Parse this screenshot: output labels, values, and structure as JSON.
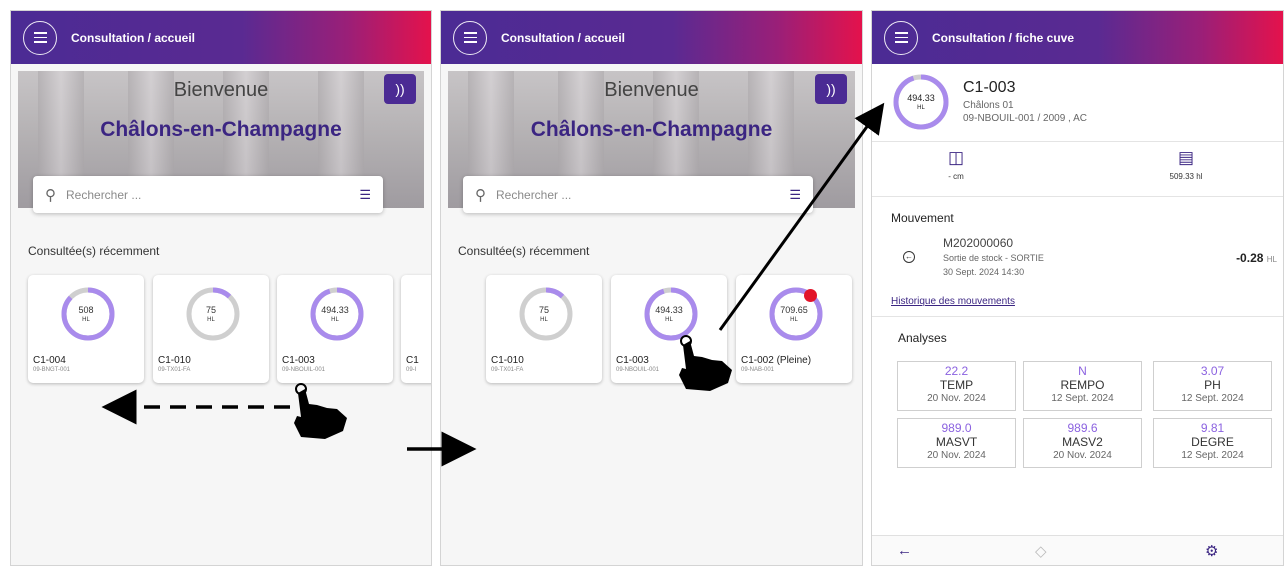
{
  "screens": [
    {
      "title": "Consultation / accueil",
      "welcome": "Bienvenue",
      "city": "Châlons-en-Champagne",
      "search_placeholder": "Rechercher ...",
      "recent_title": "Consultée(s) récemment",
      "cards": [
        {
          "value": "508",
          "unit": "HL",
          "name": "C1-004",
          "code": "09-BNGT-001",
          "fill": 0.87
        },
        {
          "value": "75",
          "unit": "HL",
          "name": "C1-010",
          "code": "09-TX01-FA",
          "fill": 0.12
        },
        {
          "value": "494.33",
          "unit": "HL",
          "name": "C1-003",
          "code": "09-NBOUIL-001",
          "fill": 0.95
        },
        {
          "value": "",
          "unit": "",
          "name": "C1",
          "code": "09-I",
          "fill": 0
        }
      ]
    },
    {
      "title": "Consultation / accueil",
      "welcome": "Bienvenue",
      "city": "Châlons-en-Champagne",
      "search_placeholder": "Rechercher ...",
      "recent_title": "Consultée(s) récemment",
      "cards": [
        {
          "value": "75",
          "unit": "HL",
          "name": "C1-010",
          "code": "09-TX01-FA",
          "fill": 0.12
        },
        {
          "value": "494.33",
          "unit": "HL",
          "name": "C1-003",
          "code": "09-NBOUIL-001",
          "fill": 0.95
        },
        {
          "value": "709.65",
          "unit": "HL",
          "name": "C1-002 (Pleine)",
          "code": "09-NAB-001",
          "fill": 1.0
        }
      ]
    }
  ],
  "detail": {
    "title": "Consultation / fiche cuve",
    "gauge_value": "494.33",
    "gauge_unit": "HL",
    "gauge_fill": 0.95,
    "tank_name": "C1-003",
    "site": "Châlons 01",
    "lot": "09-NBOUIL-001 / 2009 , AC",
    "level_label": "- cm",
    "volume_label": "509.33 hl",
    "movement_title": "Mouvement",
    "movement_id": "M202000060",
    "movement_type": "Sortie de stock - SORTIE",
    "movement_date": "30 Sept. 2024 14:30",
    "movement_qty": "-0.28",
    "movement_unit": "HL",
    "history_link": "Historique des mouvements",
    "analyses_title": "Analyses",
    "analyses": [
      {
        "value": "22.2",
        "key": "TEMP",
        "date": "20 Nov. 2024"
      },
      {
        "value": "N",
        "key": "REMPO",
        "date": "12 Sept. 2024"
      },
      {
        "value": "3.07",
        "key": "PH",
        "date": "12 Sept. 2024"
      },
      {
        "value": "989.0",
        "key": "MASVT",
        "date": "20 Nov. 2024"
      },
      {
        "value": "989.6",
        "key": "MASV2",
        "date": "20 Nov. 2024"
      },
      {
        "value": "9.81",
        "key": "DEGRE",
        "date": "12 Sept. 2024"
      }
    ]
  },
  "colors": {
    "accent": "#4b2b94",
    "gauge": "#a98bec",
    "gauge_track": "#cfcfcf",
    "alert": "#e2142a"
  },
  "icons": [
    "menu-icon",
    "rss-icon",
    "search-icon",
    "filter-list-icon",
    "hand-pointer-icon",
    "back-arrow-icon",
    "tag-icon",
    "settings-icon",
    "tank-level-icon",
    "tank-volume-icon",
    "movement-exit-icon"
  ]
}
